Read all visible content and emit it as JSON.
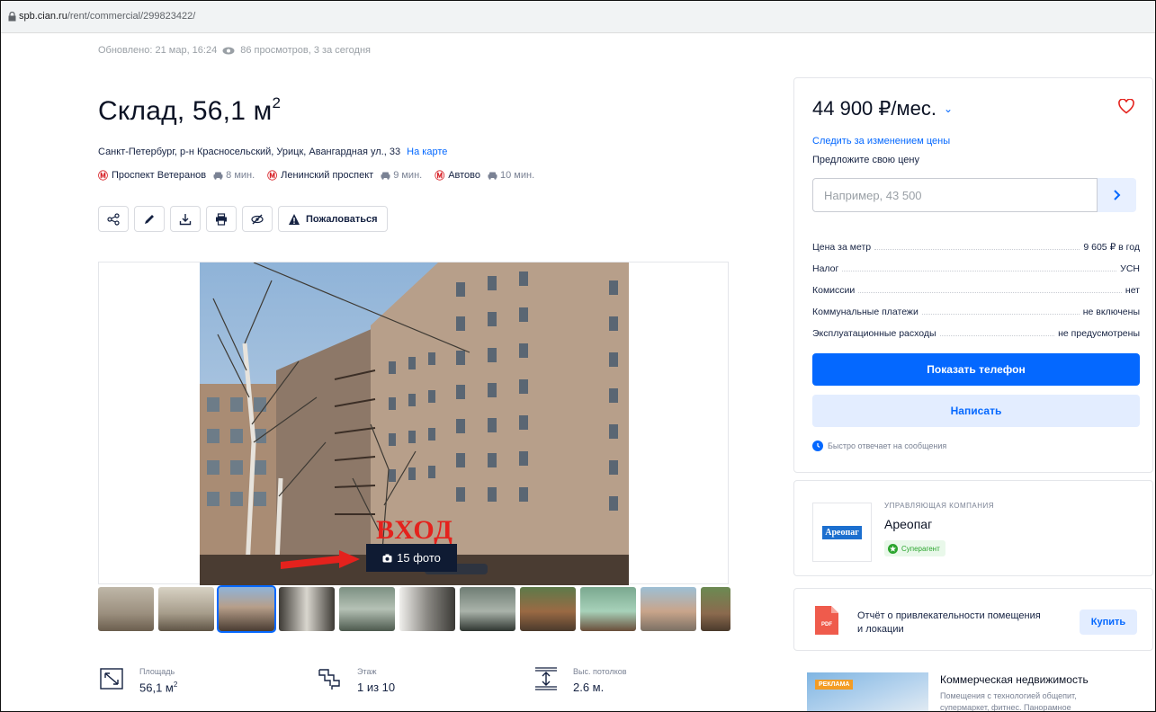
{
  "browser": {
    "url_host": "spb.cian.ru",
    "url_path": "/rent/commercial/299823422/"
  },
  "listing": {
    "updated": "Обновлено: 21 мар, 16:24",
    "views": "86 просмотров, 3 за сегодня",
    "title_main": "Склад, 56,1 м",
    "title_sup": "2",
    "address": "Санкт-Петербург, р-н Красносельский, Урицк, Авангардная ул., 33",
    "map_link": "На карте",
    "metros": [
      {
        "logo": "Ⓜ",
        "name": "Проспект Ветеранов",
        "time": "8 мин."
      },
      {
        "logo": "Ⓜ",
        "name": "Ленинский проспект",
        "time": "9 мин."
      },
      {
        "logo": "Ⓜ",
        "name": "Автово",
        "time": "10 мин."
      }
    ],
    "actions": {
      "share_icon": "share-icon",
      "edit_icon": "pencil-icon",
      "download_icon": "download-icon",
      "print_icon": "print-icon",
      "hide_icon": "hide-icon",
      "report_label": "Пожаловаться"
    },
    "photo_overlay_text": "ВХОД",
    "photo_count": "15 фото",
    "thumbnails_count_visible": 11,
    "active_thumbnail": 3,
    "specs": [
      {
        "icon": "area-icon",
        "label": "Площадь",
        "value": "56,1 м",
        "sup": "2"
      },
      {
        "icon": "stairs-icon",
        "label": "Этаж",
        "value": "1 из 10",
        "sup": ""
      },
      {
        "icon": "ceiling-height-icon",
        "label": "Выс. потолков",
        "value": "2.6 м.",
        "sup": ""
      }
    ]
  },
  "sidebar": {
    "price": "44 900 ₽/мес.",
    "price_caret": "⌄",
    "follow_price": "Следить за изменением цены",
    "offer_label": "Предложите свою цену",
    "offer_placeholder": "Например, 43 500",
    "details": [
      {
        "label": "Цена за метр",
        "value": "9 605 ₽ в год"
      },
      {
        "label": "Налог",
        "value": "УСН"
      },
      {
        "label": "Комиссии",
        "value": "нет"
      },
      {
        "label": "Коммунальные платежи",
        "value": "не включены"
      },
      {
        "label": "Эксплуатационные расходы",
        "value": "не предусмотрены"
      }
    ],
    "show_phone": "Показать телефон",
    "write": "Написать",
    "quick_reply": "Быстро отвечает на сообщения",
    "company": {
      "kind": "УПРАВЛЯЮЩАЯ КОМПАНИЯ",
      "name": "Ареопаг",
      "logo_text": "Ареопаг",
      "badge": "Суперагент"
    },
    "report": {
      "pdf_label": "PDF",
      "title": "Отчёт о привлекательности помещения и локации",
      "buy": "Купить"
    },
    "ad": {
      "badge": "РЕКЛАМА",
      "title": "Коммерческая недвижимость",
      "text": "Помещения с технологией общепит, супермаркет, фитнес. Панорамное"
    }
  },
  "colors": {
    "accent": "#0468ff",
    "accent_light": "#e3edff",
    "metro_red": "#d8262c",
    "text_dark": "#152242",
    "muted": "#7a8294",
    "superagent_green": "#2ba52e",
    "heart_red": "#e4221d"
  }
}
